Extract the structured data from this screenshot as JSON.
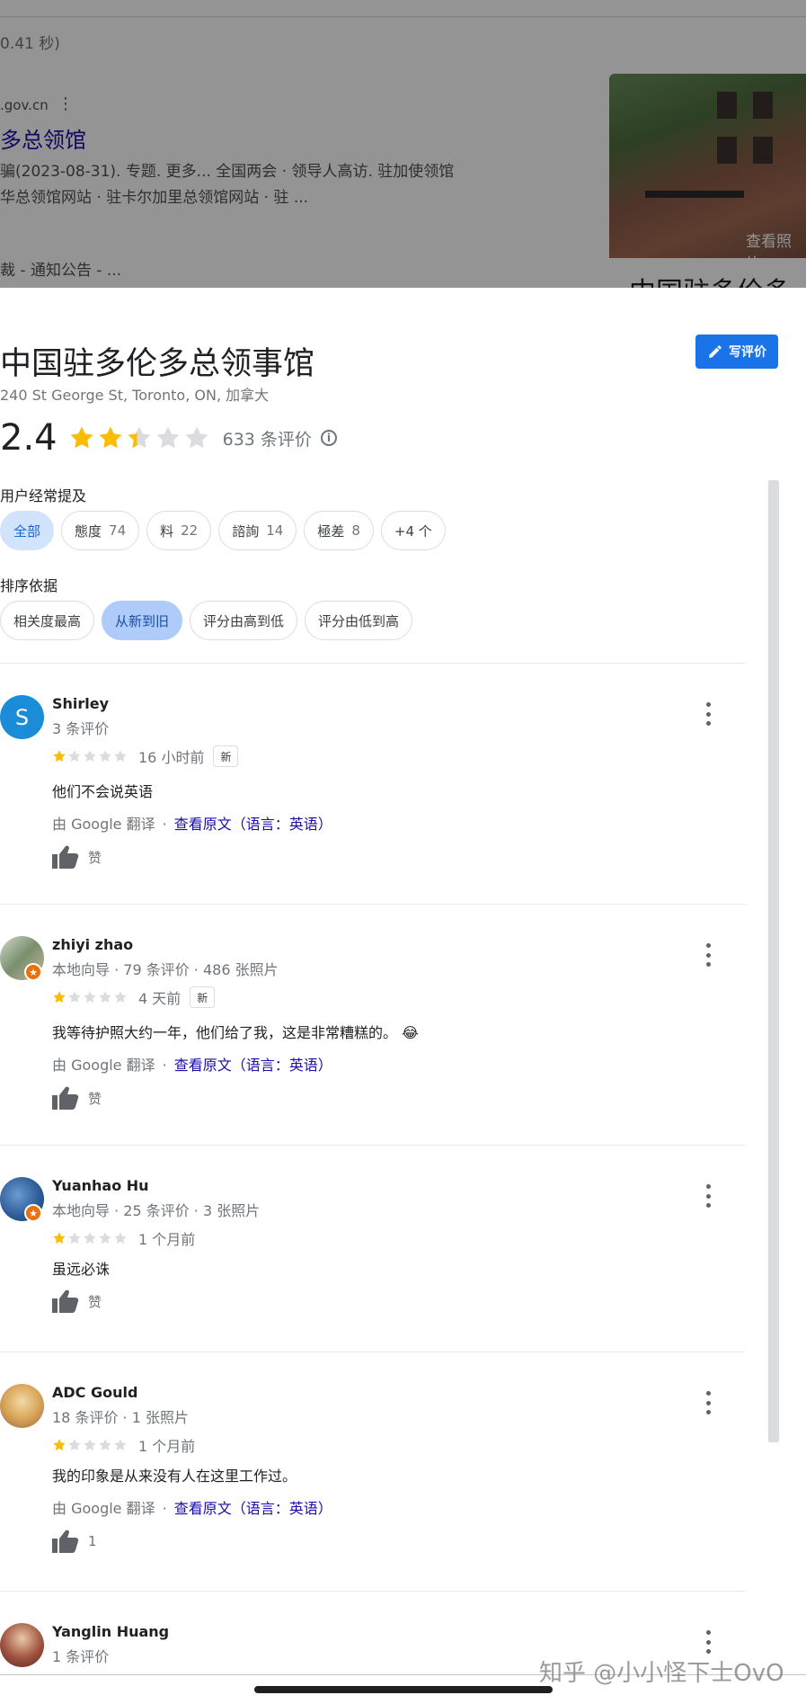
{
  "background_page": {
    "stats": "0.41 秒)",
    "domain": ".gov.cn",
    "result_title": "多总领馆",
    "snippet_line1": "骗(2023-08-31). 专题. 更多... 全国两会 · 领导人高访. 驻加使领馆",
    "snippet_line2": "华总领馆网站 · 驻卡尔加里总领馆网站 · 驻 ...",
    "snippet_line3": "裁 - 通知公告 - ...",
    "photo_label": "查看照片",
    "side_title": "中国驻多伦多"
  },
  "place": {
    "title": "中国驻多伦多总领事馆",
    "address": "240 St George St, Toronto, ON, 加拿大",
    "write_review_label": "写评价",
    "rating": "2.4",
    "rating_stars": 2.4,
    "review_count": "633 条评价"
  },
  "mentions": {
    "label": "用户经常提及",
    "chips": [
      {
        "label": "全部",
        "count": ""
      },
      {
        "label": "態度",
        "count": "74"
      },
      {
        "label": "料",
        "count": "22"
      },
      {
        "label": "諮詢",
        "count": "14"
      },
      {
        "label": "極差",
        "count": "8"
      },
      {
        "label": "+4 个",
        "count": ""
      }
    ]
  },
  "sort": {
    "label": "排序依据",
    "options": [
      "相关度最高",
      "从新到旧",
      "评分由高到低",
      "评分由低到高"
    ],
    "selected": "从新到旧"
  },
  "reviews": [
    {
      "name": "Shirley",
      "avatar_letter": "S",
      "meta": "3 条评价",
      "stars": 1,
      "time": "16 小时前",
      "new_tag": "新",
      "text": "他们不会说英语",
      "translated_by": "由 Google 翻译",
      "view_original": "查看原文（语言：英语）",
      "like_label": "赞"
    },
    {
      "name": "zhiyi zhao",
      "meta": "本地向导 · 79 条评价 · 486 张照片",
      "stars": 1,
      "time": "4 天前",
      "new_tag": "新",
      "text": "我等待护照大约一年，他们给了我，这是非常糟糕的。 😂",
      "translated_by": "由 Google 翻译",
      "view_original": "查看原文（语言：英语）",
      "like_label": "赞"
    },
    {
      "name": "Yuanhao Hu",
      "meta": "本地向导 · 25 条评价 · 3 张照片",
      "stars": 1,
      "time": "1 个月前",
      "text": "虽远必诛",
      "like_label": "赞"
    },
    {
      "name": "ADC Gould",
      "meta": "18 条评价 · 1 张照片",
      "stars": 1,
      "time": "1 个月前",
      "text": "我的印象是从来没有人在这里工作过。",
      "translated_by": "由 Google 翻译",
      "view_original": "查看原文（语言：英语）",
      "like_label": "1"
    },
    {
      "name": "Yanglin Huang",
      "meta": "1 条评价"
    }
  ],
  "watermark": "知乎 @小小怪下士OvO",
  "colors": {
    "star_filled": "#fbbc04",
    "star_empty": "#dadce0",
    "accent_blue": "#1a73e8",
    "link": "#1a0dab"
  }
}
